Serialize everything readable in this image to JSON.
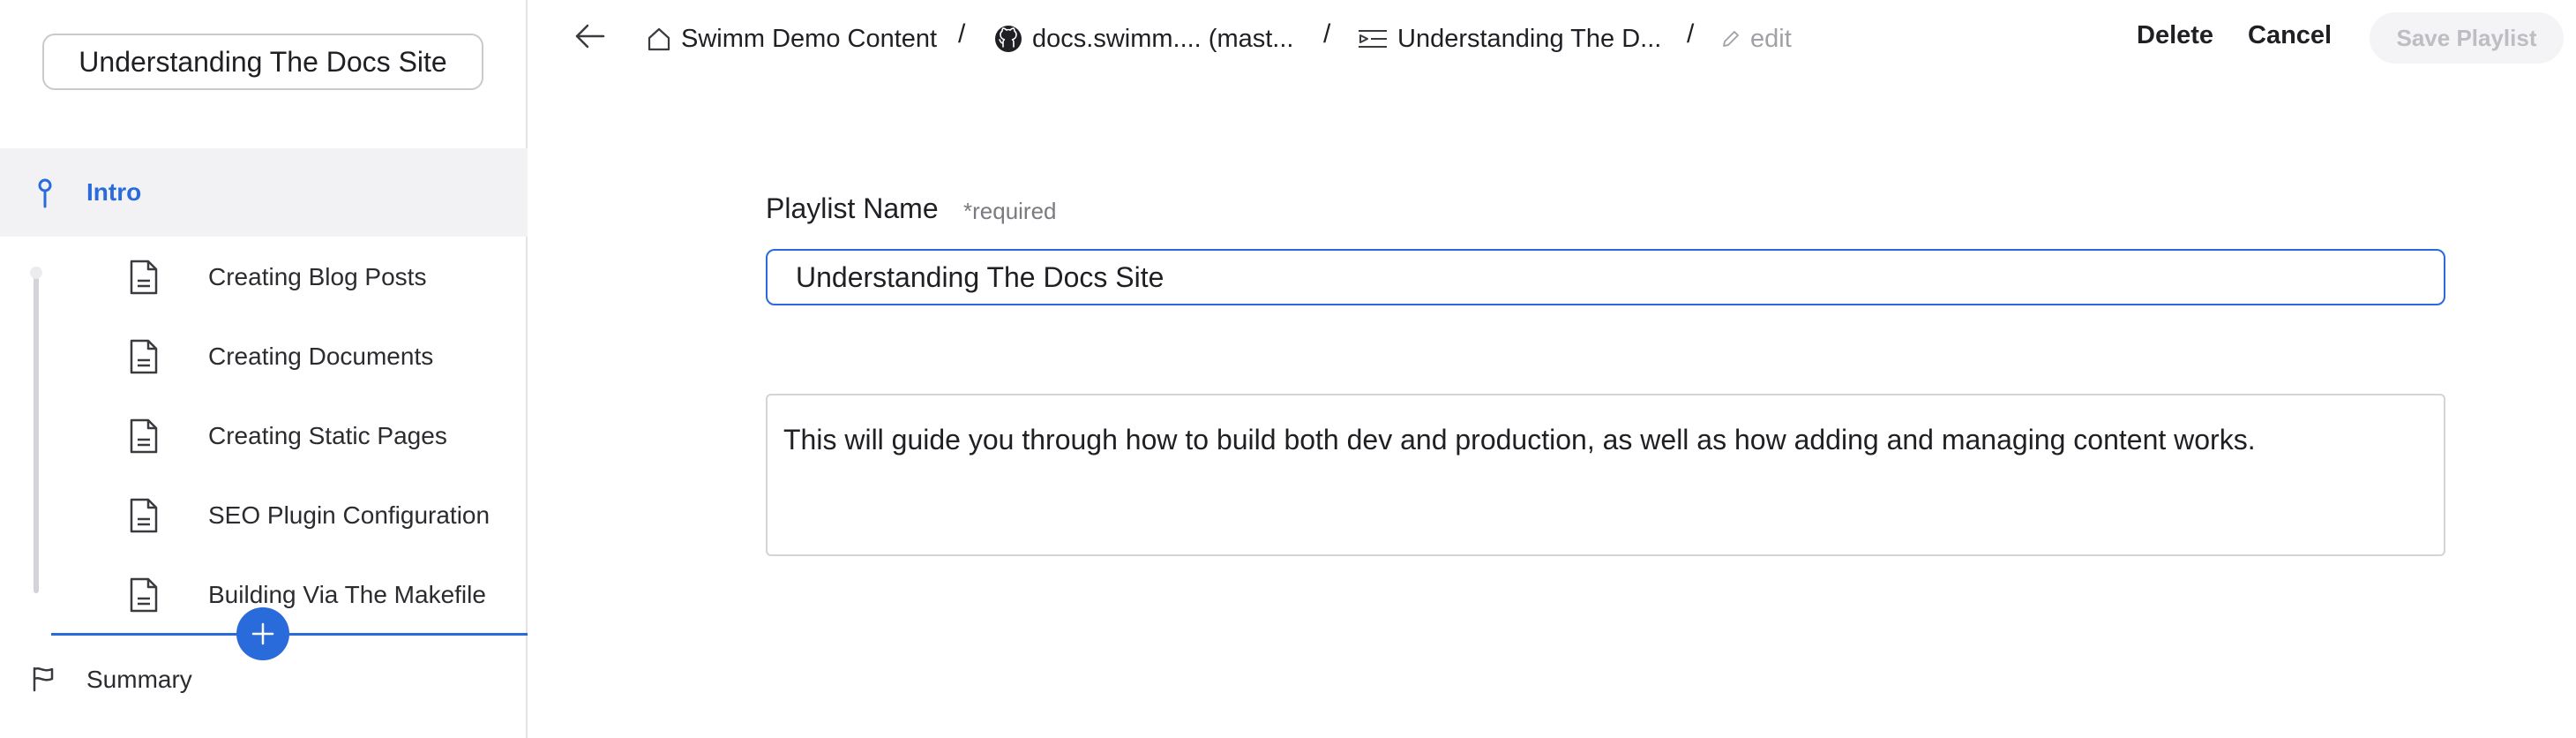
{
  "sidebar": {
    "playlist_title": "Understanding The Docs Site",
    "intro_label": "Intro",
    "items": [
      {
        "label": "Creating Blog Posts",
        "icon": "document-icon"
      },
      {
        "label": "Creating Documents",
        "icon": "document-icon"
      },
      {
        "label": "Creating Static Pages",
        "icon": "document-icon"
      },
      {
        "label": "SEO Plugin Configuration",
        "icon": "document-icon"
      },
      {
        "label": "Building Via The Makefile",
        "icon": "document-icon"
      }
    ],
    "add_label": "+",
    "summary_label": "Summary"
  },
  "header": {
    "breadcrumbs": [
      {
        "label": "Swimm Demo Content",
        "icon": "home-icon"
      },
      {
        "label": "docs.swimm.... (mast...",
        "icon": "github-icon"
      },
      {
        "label": "Understanding The D...",
        "icon": "playlist-icon"
      },
      {
        "label": "edit",
        "icon": "pencil-icon"
      }
    ],
    "separator": "/",
    "delete_label": "Delete",
    "cancel_label": "Cancel",
    "save_label": "Save Playlist"
  },
  "form": {
    "name_label": "Playlist Name",
    "required_label": "*required",
    "name_value": "Understanding The Docs Site",
    "description_value": "This will guide you through how to build both dev and production, as well as how adding and managing content works."
  },
  "colors": {
    "accent": "#2a6bdc",
    "sidebar_selected_bg": "#f2f2f4",
    "disabled_text": "#bdbdc2"
  }
}
